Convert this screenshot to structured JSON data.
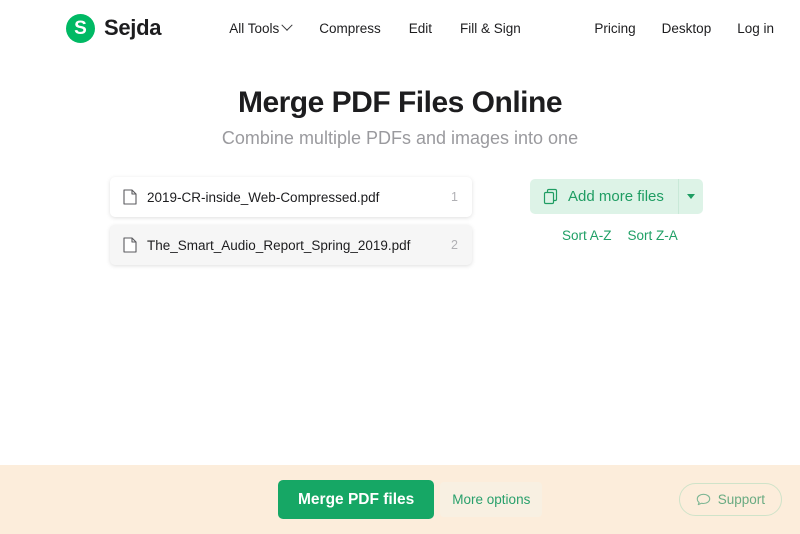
{
  "header": {
    "brand": {
      "mark_letter": "S",
      "name": "Sejda"
    },
    "nav_main": [
      {
        "label": "All Tools",
        "has_caret": true
      },
      {
        "label": "Compress",
        "has_caret": false
      },
      {
        "label": "Edit",
        "has_caret": false
      },
      {
        "label": "Fill & Sign",
        "has_caret": false
      }
    ],
    "nav_right": [
      {
        "label": "Pricing"
      },
      {
        "label": "Desktop"
      },
      {
        "label": "Log in"
      }
    ]
  },
  "hero": {
    "title": "Merge PDF Files Online",
    "subtitle": "Combine multiple PDFs and images into one"
  },
  "files": [
    {
      "name": "2019-CR-inside_Web-Compressed.pdf",
      "index": "1"
    },
    {
      "name": "The_Smart_Audio_Report_Spring_2019.pdf",
      "index": "2"
    }
  ],
  "side_panel": {
    "add_more_files_label": "Add more files",
    "sort_az_label": "Sort A-Z",
    "sort_za_label": "Sort Z-A"
  },
  "bottom_bar": {
    "merge_label": "Merge PDF files",
    "more_options_label": "More options",
    "support_label": "Support"
  },
  "colors": {
    "brand_green": "#00b964",
    "action_green": "#16a765",
    "link_green": "#20a066",
    "mint_fill": "#ddf3e7",
    "bottom_bar": "#fceddb",
    "muted_text": "#9a9a9e"
  }
}
